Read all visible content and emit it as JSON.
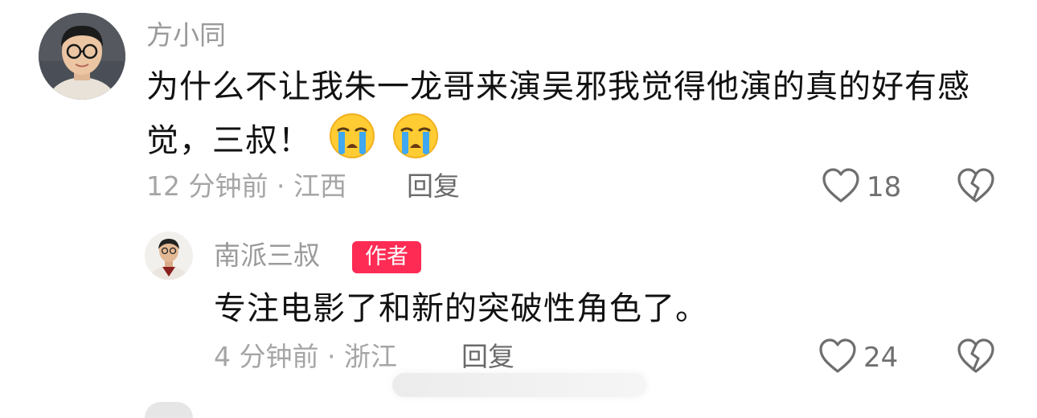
{
  "comments": [
    {
      "username": "方小同",
      "text": "为什么不让我朱一龙哥来演吴邪我觉得他演的真的好有感觉，三叔！",
      "emojis": [
        "crying-face-icon",
        "crying-face-icon"
      ],
      "time_location": "12 分钟前 · 江西",
      "reply_label": "回复",
      "like_count": "18"
    }
  ],
  "reply": {
    "username": "南派三叔",
    "badge": "作者",
    "text": "专注电影了和新的突破性角色了。",
    "time_location": "4 分钟前 · 浙江",
    "reply_label": "回复",
    "like_count": "24"
  },
  "colors": {
    "badge_bg": "#fe2c55",
    "username": "#9a9a9a",
    "meta": "#a5a5a5",
    "text": "#111111"
  }
}
